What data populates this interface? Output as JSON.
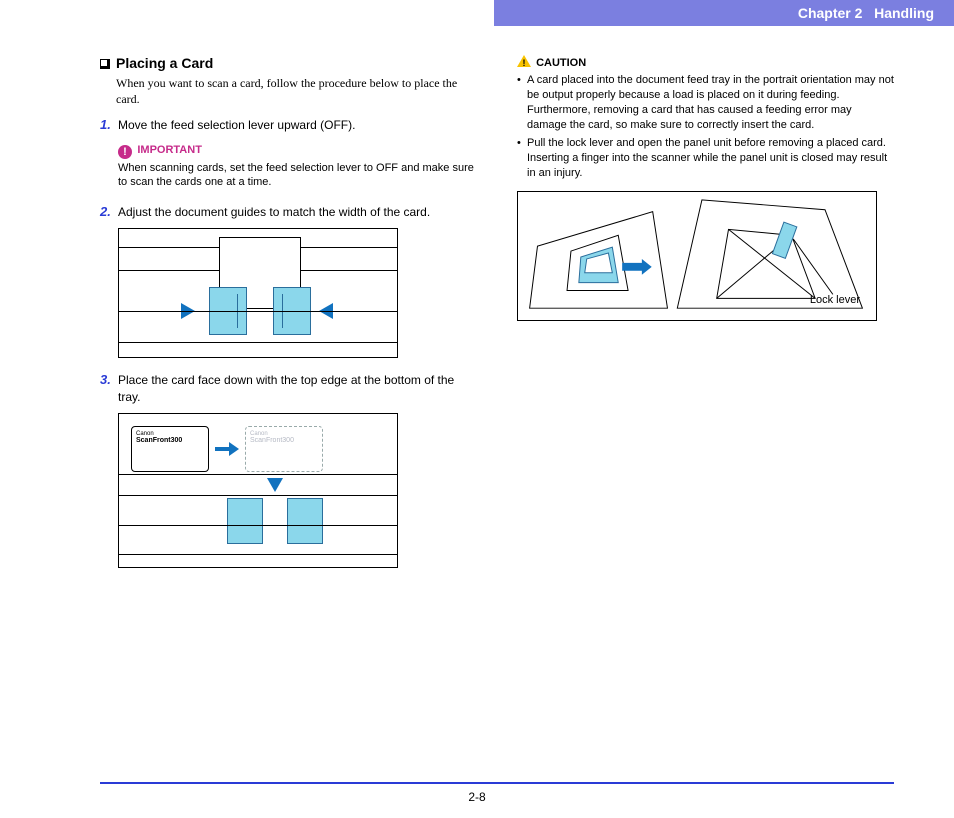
{
  "header": {
    "chapter": "Chapter 2",
    "title": "Handling"
  },
  "section": {
    "heading": "Placing a Card",
    "intro": "When you want to scan a card, follow the procedure below to place the card."
  },
  "steps": {
    "s1": {
      "text": "Move the feed selection lever upward (OFF)."
    },
    "important": {
      "label": "IMPORTANT",
      "text": "When scanning cards, set the feed selection lever to OFF and make sure to scan the cards one at a time."
    },
    "s2": {
      "text": "Adjust the document guides to match the width of the card."
    },
    "s3": {
      "text": "Place the card face down with the top edge at the bottom of the tray."
    }
  },
  "fig2": {
    "card_brand": "Canon",
    "card_model": "ScanFront300",
    "ghost_brand": "Canon",
    "ghost_model": "ScanFront300"
  },
  "caution": {
    "label": "CAUTION",
    "items": [
      "A card placed into the document feed tray in the portrait orientation may not be output properly because a load is placed on it during feeding. Furthermore, removing a card that has caused a feeding error may damage the card, so make sure to correctly insert the card.",
      "Pull the lock lever and open the panel unit before removing a placed card. Inserting a finger into the scanner while the panel unit is closed may result in an injury."
    ]
  },
  "fig3": {
    "lock_label": "Lock lever"
  },
  "footer": {
    "page": "2-8"
  }
}
